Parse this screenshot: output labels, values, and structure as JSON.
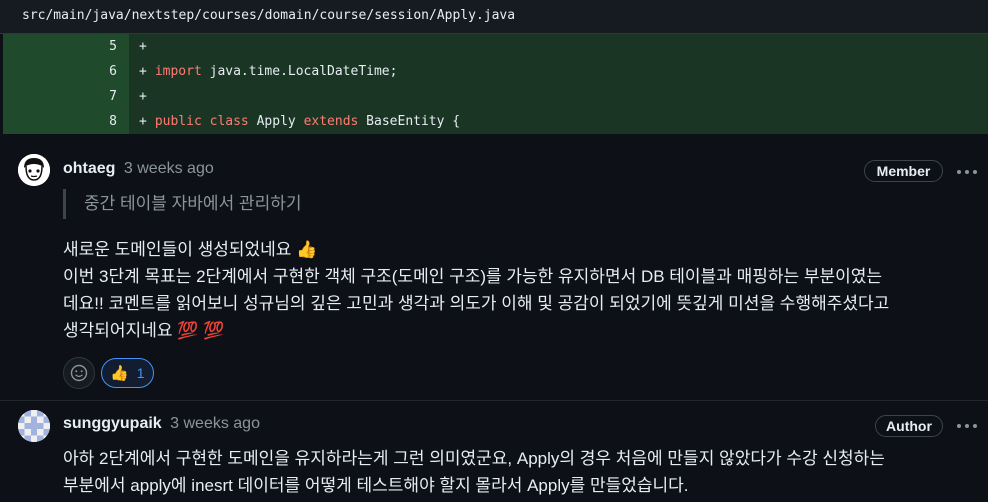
{
  "file": {
    "path": "src/main/java/nextstep/courses/domain/course/session/Apply.java"
  },
  "diff": {
    "lines": [
      {
        "num": "5",
        "marker": "+",
        "tokens": []
      },
      {
        "num": "6",
        "marker": "+",
        "tokens": [
          {
            "text": "import",
            "kw": true
          },
          {
            "text": " java.time.LocalDateTime;",
            "kw": false
          }
        ]
      },
      {
        "num": "7",
        "marker": "+",
        "tokens": []
      },
      {
        "num": "8",
        "marker": "+",
        "tokens": [
          {
            "text": "public",
            "kw": true
          },
          {
            "text": " ",
            "kw": false
          },
          {
            "text": "class",
            "kw": true
          },
          {
            "text": " Apply ",
            "kw": false
          },
          {
            "text": "extends",
            "kw": true
          },
          {
            "text": " BaseEntity {",
            "kw": false
          }
        ]
      }
    ]
  },
  "comments": [
    {
      "author": "ohtaeg",
      "time": "3 weeks ago",
      "badge": "Member",
      "quote": "중간 테이블 자바에서 관리하기",
      "body": [
        "새로운 도메인들이 생성되었네요 👍",
        "이번 3단계 목표는 2단계에서 구현한 객체 구조(도메인 구조)를 가능한 유지하면서 DB 테이블과 매핑하는 부분이였는",
        "데요!! 코멘트를 읽어보니 성규님의 깊은 고민과 생각과 의도가 이해 및 공감이 되었기에 뜻깊게 미션을 수행해주셨다고",
        "생각되어지네요 💯 💯"
      ],
      "reaction": {
        "emoji": "👍",
        "count": "1"
      }
    },
    {
      "author": "sunggyupaik",
      "time": "3 weeks ago",
      "badge": "Author",
      "body": [
        "아하 2단계에서 구현한 도메인을 유지하라는게 그런 의미였군요, Apply의 경우 처음에 만들지 않았다가 수강 신청하는",
        "부분에서 apply에 inesrt 데이터를 어떻게 테스트해야 할지 몰라서 Apply를 만들었습니다."
      ]
    }
  ],
  "icons": {
    "kebab": "kebab-horizontal-icon",
    "smiley": "smiley-icon",
    "thumbs_up": "thumbs-up-icon"
  },
  "colors": {
    "keyword": "#ff7b72",
    "accent": "#4493f8",
    "added_line": "#1b3524"
  }
}
